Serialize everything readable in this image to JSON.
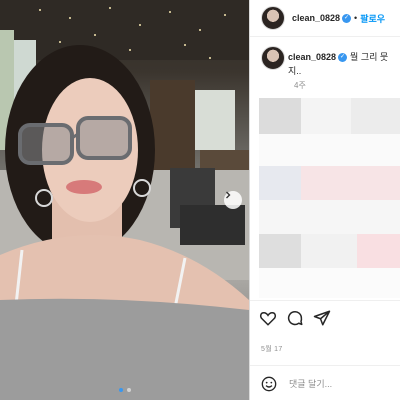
{
  "header": {
    "username": "clean_0828",
    "separator": "•",
    "follow_label": "팔로우"
  },
  "caption": {
    "username": "clean_0828",
    "text_line1": "뭘 그리 뭇",
    "text_line2": "지..",
    "time_ago": "4주"
  },
  "post": {
    "date": "5월 17",
    "slide_count": 2,
    "active_slide": 1
  },
  "comment": {
    "placeholder": "댓글 달기..."
  },
  "icons": {
    "verified": "verified-badge-icon",
    "like": "heart-icon",
    "comment": "comment-icon",
    "share": "share-icon",
    "emoji": "emoji-icon",
    "next": "chevron-right-icon"
  },
  "colors": {
    "accent": "#0095f6",
    "verified": "#3897f0",
    "text": "#262626",
    "muted": "#8e8e8e"
  }
}
